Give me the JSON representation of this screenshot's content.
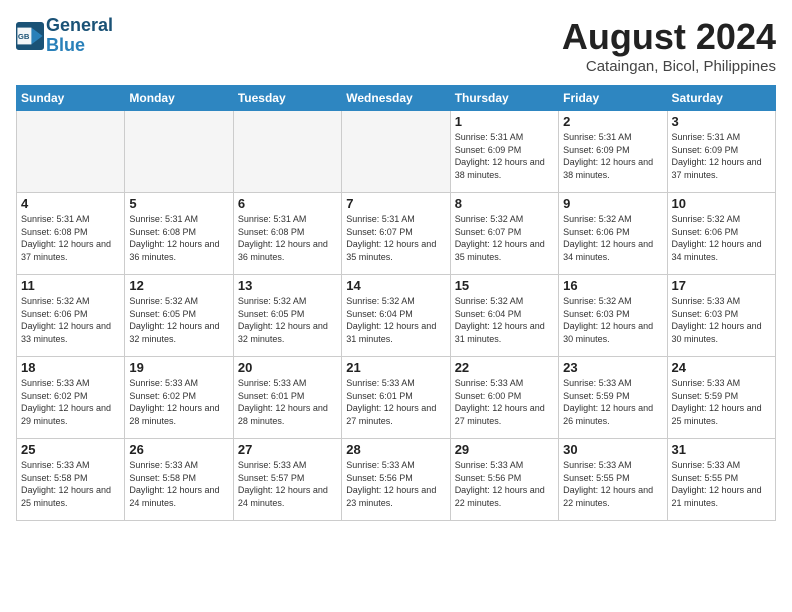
{
  "header": {
    "logo_line1": "General",
    "logo_line2": "Blue",
    "month_title": "August 2024",
    "location": "Cataingan, Bicol, Philippines"
  },
  "weekdays": [
    "Sunday",
    "Monday",
    "Tuesday",
    "Wednesday",
    "Thursday",
    "Friday",
    "Saturday"
  ],
  "weeks": [
    [
      {
        "day": "",
        "empty": true
      },
      {
        "day": "",
        "empty": true
      },
      {
        "day": "",
        "empty": true
      },
      {
        "day": "",
        "empty": true
      },
      {
        "day": "1",
        "sunrise": "5:31 AM",
        "sunset": "6:09 PM",
        "daylight": "12 hours and 38 minutes."
      },
      {
        "day": "2",
        "sunrise": "5:31 AM",
        "sunset": "6:09 PM",
        "daylight": "12 hours and 38 minutes."
      },
      {
        "day": "3",
        "sunrise": "5:31 AM",
        "sunset": "6:09 PM",
        "daylight": "12 hours and 37 minutes."
      }
    ],
    [
      {
        "day": "4",
        "sunrise": "5:31 AM",
        "sunset": "6:08 PM",
        "daylight": "12 hours and 37 minutes."
      },
      {
        "day": "5",
        "sunrise": "5:31 AM",
        "sunset": "6:08 PM",
        "daylight": "12 hours and 36 minutes."
      },
      {
        "day": "6",
        "sunrise": "5:31 AM",
        "sunset": "6:08 PM",
        "daylight": "12 hours and 36 minutes."
      },
      {
        "day": "7",
        "sunrise": "5:31 AM",
        "sunset": "6:07 PM",
        "daylight": "12 hours and 35 minutes."
      },
      {
        "day": "8",
        "sunrise": "5:32 AM",
        "sunset": "6:07 PM",
        "daylight": "12 hours and 35 minutes."
      },
      {
        "day": "9",
        "sunrise": "5:32 AM",
        "sunset": "6:06 PM",
        "daylight": "12 hours and 34 minutes."
      },
      {
        "day": "10",
        "sunrise": "5:32 AM",
        "sunset": "6:06 PM",
        "daylight": "12 hours and 34 minutes."
      }
    ],
    [
      {
        "day": "11",
        "sunrise": "5:32 AM",
        "sunset": "6:06 PM",
        "daylight": "12 hours and 33 minutes."
      },
      {
        "day": "12",
        "sunrise": "5:32 AM",
        "sunset": "6:05 PM",
        "daylight": "12 hours and 32 minutes."
      },
      {
        "day": "13",
        "sunrise": "5:32 AM",
        "sunset": "6:05 PM",
        "daylight": "12 hours and 32 minutes."
      },
      {
        "day": "14",
        "sunrise": "5:32 AM",
        "sunset": "6:04 PM",
        "daylight": "12 hours and 31 minutes."
      },
      {
        "day": "15",
        "sunrise": "5:32 AM",
        "sunset": "6:04 PM",
        "daylight": "12 hours and 31 minutes."
      },
      {
        "day": "16",
        "sunrise": "5:32 AM",
        "sunset": "6:03 PM",
        "daylight": "12 hours and 30 minutes."
      },
      {
        "day": "17",
        "sunrise": "5:33 AM",
        "sunset": "6:03 PM",
        "daylight": "12 hours and 30 minutes."
      }
    ],
    [
      {
        "day": "18",
        "sunrise": "5:33 AM",
        "sunset": "6:02 PM",
        "daylight": "12 hours and 29 minutes."
      },
      {
        "day": "19",
        "sunrise": "5:33 AM",
        "sunset": "6:02 PM",
        "daylight": "12 hours and 28 minutes."
      },
      {
        "day": "20",
        "sunrise": "5:33 AM",
        "sunset": "6:01 PM",
        "daylight": "12 hours and 28 minutes."
      },
      {
        "day": "21",
        "sunrise": "5:33 AM",
        "sunset": "6:01 PM",
        "daylight": "12 hours and 27 minutes."
      },
      {
        "day": "22",
        "sunrise": "5:33 AM",
        "sunset": "6:00 PM",
        "daylight": "12 hours and 27 minutes."
      },
      {
        "day": "23",
        "sunrise": "5:33 AM",
        "sunset": "5:59 PM",
        "daylight": "12 hours and 26 minutes."
      },
      {
        "day": "24",
        "sunrise": "5:33 AM",
        "sunset": "5:59 PM",
        "daylight": "12 hours and 25 minutes."
      }
    ],
    [
      {
        "day": "25",
        "sunrise": "5:33 AM",
        "sunset": "5:58 PM",
        "daylight": "12 hours and 25 minutes."
      },
      {
        "day": "26",
        "sunrise": "5:33 AM",
        "sunset": "5:58 PM",
        "daylight": "12 hours and 24 minutes."
      },
      {
        "day": "27",
        "sunrise": "5:33 AM",
        "sunset": "5:57 PM",
        "daylight": "12 hours and 24 minutes."
      },
      {
        "day": "28",
        "sunrise": "5:33 AM",
        "sunset": "5:56 PM",
        "daylight": "12 hours and 23 minutes."
      },
      {
        "day": "29",
        "sunrise": "5:33 AM",
        "sunset": "5:56 PM",
        "daylight": "12 hours and 22 minutes."
      },
      {
        "day": "30",
        "sunrise": "5:33 AM",
        "sunset": "5:55 PM",
        "daylight": "12 hours and 22 minutes."
      },
      {
        "day": "31",
        "sunrise": "5:33 AM",
        "sunset": "5:55 PM",
        "daylight": "12 hours and 21 minutes."
      }
    ]
  ]
}
